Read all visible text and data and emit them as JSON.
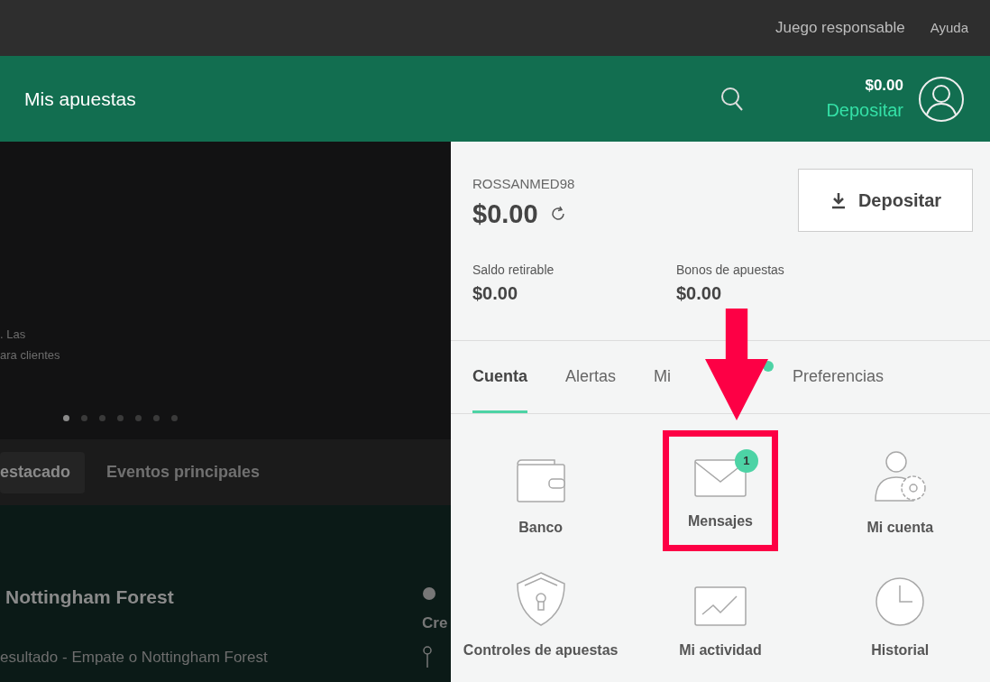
{
  "top_links": [
    "Juego responsable",
    "Ayuda"
  ],
  "header": {
    "title": "Mis apuestas",
    "balance": "$0.00",
    "deposit_link": "Depositar"
  },
  "hero": {
    "text_lines": [
      ". Las",
      "ara clientes"
    ],
    "dots": [
      {
        "selected": true
      },
      {
        "selected": false
      },
      {
        "selected": false
      },
      {
        "selected": false
      },
      {
        "selected": false
      },
      {
        "selected": false
      },
      {
        "selected": false
      }
    ]
  },
  "event_tabs": [
    {
      "label": "estacado",
      "selected": true
    },
    {
      "label": "Eventos principales",
      "selected": false
    }
  ],
  "event": {
    "title": "Nottingham Forest",
    "market": "esultado - Empate o Nottingham Forest",
    "side_title": "Cre"
  },
  "account": {
    "username": "ROSSANMED98",
    "balance": "$0.00",
    "deposit_button": "Depositar",
    "balances": [
      {
        "label": "Saldo retirable",
        "value": "$0.00"
      },
      {
        "label": "Bonos de apuestas",
        "value": "$0.00"
      }
    ],
    "tabs": [
      {
        "label": "Cuenta",
        "selected": true,
        "dot": false
      },
      {
        "label": "Alertas",
        "selected": false,
        "dot": false
      },
      {
        "label": "Mi",
        "selected": false,
        "dot": true
      },
      {
        "label": "Preferencias",
        "selected": false,
        "dot": false
      }
    ],
    "tiles": [
      {
        "kind": "wallet",
        "label": "Banco",
        "highlighted": false
      },
      {
        "kind": "envelope",
        "label": "Mensajes",
        "badge": "1",
        "highlighted": true
      },
      {
        "kind": "user-gear",
        "label": "Mi cuenta",
        "highlighted": false
      },
      {
        "kind": "shield",
        "label": "Controles de apuestas",
        "highlighted": false
      },
      {
        "kind": "chart",
        "label": "Mi actividad",
        "highlighted": false
      },
      {
        "kind": "clock",
        "label": "Historial",
        "highlighted": false
      }
    ]
  }
}
